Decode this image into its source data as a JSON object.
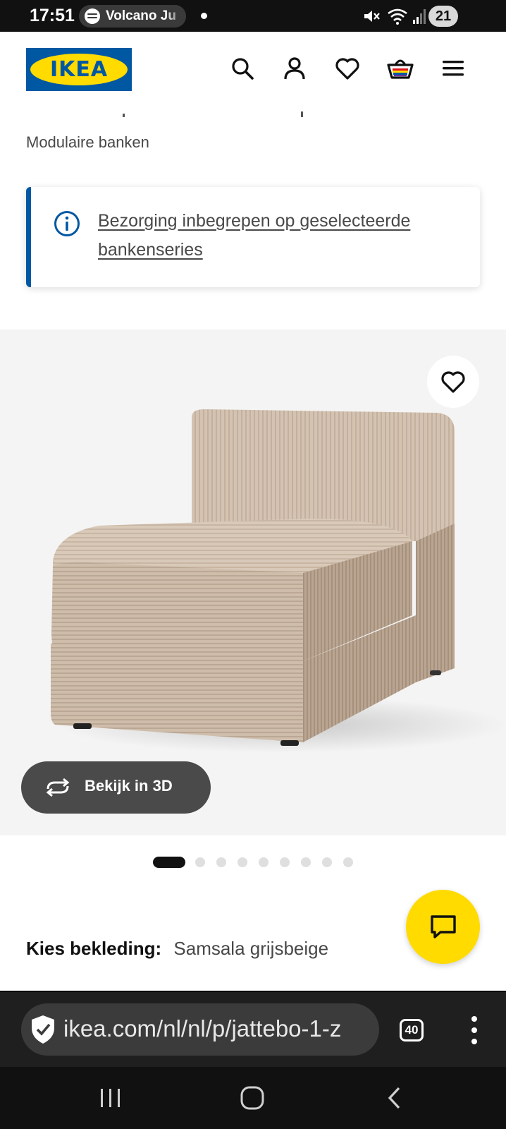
{
  "status_bar": {
    "time": "17:51",
    "spotify_label": "Volcano Ju",
    "battery": "21"
  },
  "header": {
    "logo_text": "IKEA",
    "colors": {
      "brand_blue": "#0058a3",
      "brand_yellow": "#ffdb00"
    },
    "icons": [
      "search-icon",
      "account-icon",
      "favorites-icon",
      "cart-icon",
      "menu-icon"
    ]
  },
  "page": {
    "category": "Modulaire banken",
    "info_banner": "Bezorging inbegrepen op geselecteerde bankenseries"
  },
  "product_image": {
    "view3d_label": "Bekijk in 3D",
    "carousel": {
      "total": 9,
      "active": 1
    }
  },
  "options": {
    "cover_label": "Kies bekleding:",
    "cover_value": "Samsala grijsbeige"
  },
  "browser": {
    "url": "ikea.com/nl/nl/p/jattebo-1-z",
    "tab_count": "40"
  }
}
